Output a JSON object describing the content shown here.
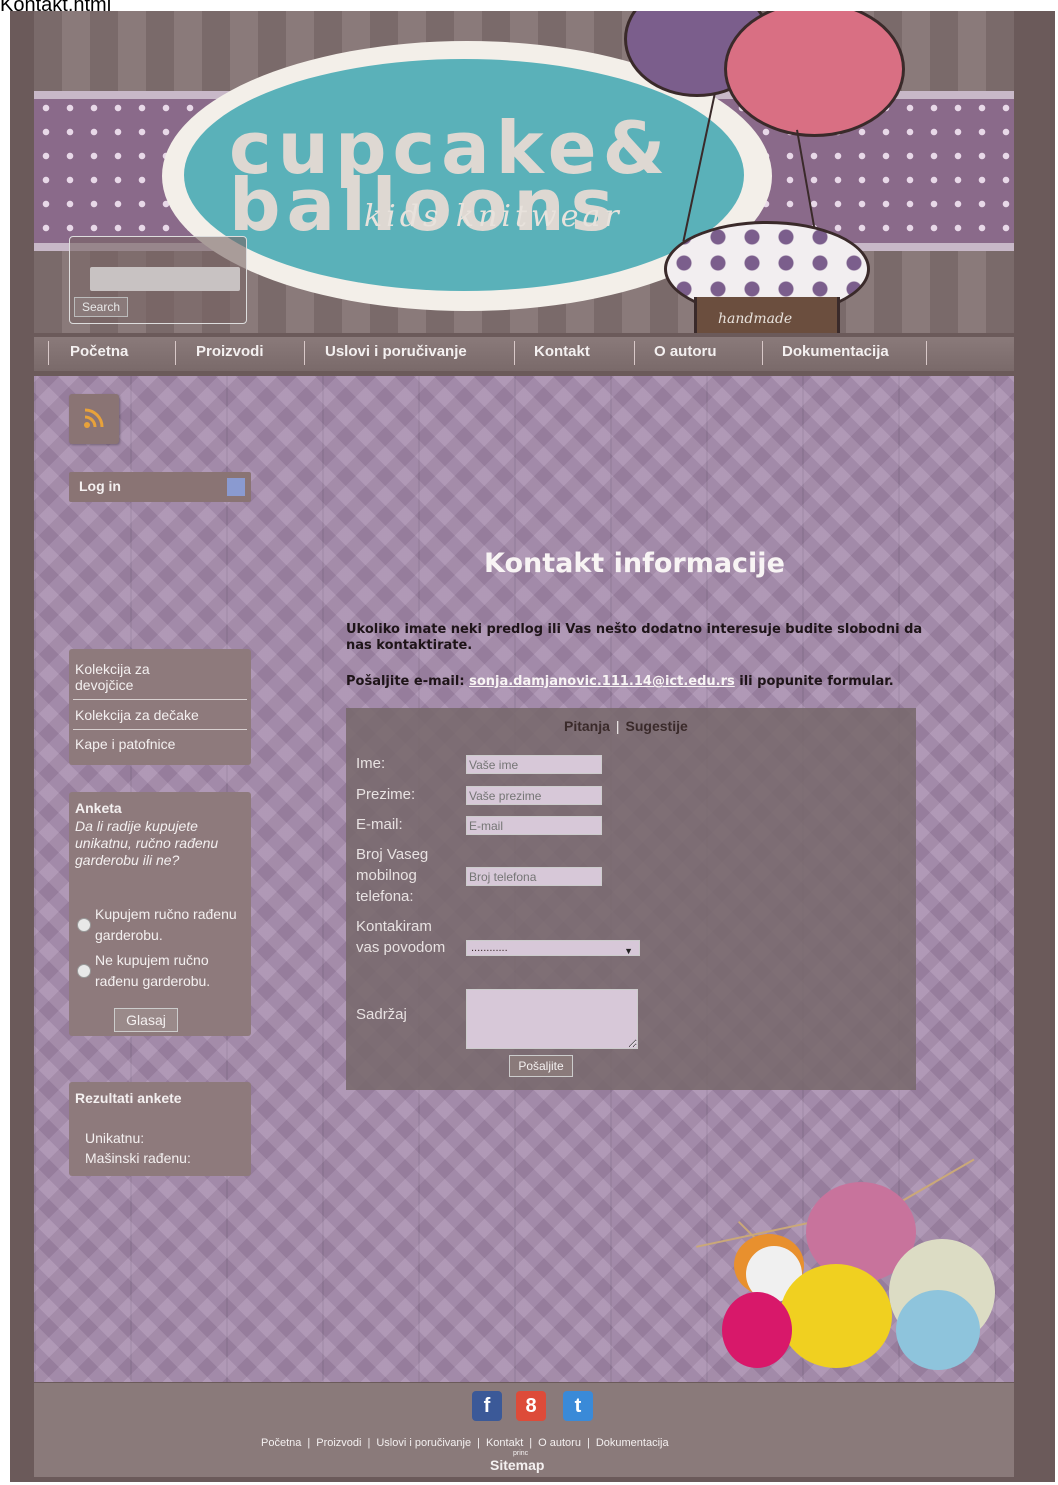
{
  "document_title": "Kontakt.html",
  "header": {
    "logo_line1": "cupcake&",
    "logo_line2": "balloons",
    "logo_sub": "kids knitwear",
    "badge": "handmade",
    "search_button": "Search",
    "search_value": ""
  },
  "nav": {
    "items": [
      "Početna",
      "Proizvodi",
      "Uslovi i poručivanje",
      "Kontakt",
      "O autoru",
      "Dokumentacija"
    ]
  },
  "sidebar": {
    "rss_icon": "rss-icon",
    "login_label": "Log in",
    "menu": [
      "Kolekcija za devojčice",
      "Kolekcija za dečake",
      "Kape i patofnice"
    ],
    "poll": {
      "title": "Anketa",
      "question": "Da li radije kupujete unikatnu, ručno rađenu garderobu ili ne?",
      "options": [
        "Kupujem ručno rađenu garderobu.",
        "Ne kupujem ručno rađenu garderobu."
      ],
      "vote_button": "Glasaj"
    },
    "results": {
      "title": "Rezultati ankete",
      "rows": [
        "Unikatnu:",
        "Mašinski rađenu:"
      ]
    }
  },
  "main": {
    "title": "Kontakt informacije",
    "intro": "Ukoliko imate neki predlog ili Vas nešto dodatno interesuje budite slobodni da nas kontaktirate.",
    "email_prefix": "Pošaljite e-mail:",
    "email": "sonja.damjanovic.111.14@ict.edu.rs",
    "email_suffix": "ili popunite formular.",
    "tabs": [
      "Pitanja",
      "Sugestije"
    ],
    "form": {
      "name_label": "Ime:",
      "name_placeholder": "Vaše ime",
      "surname_label": "Prezime:",
      "surname_placeholder": "Vaše prezime",
      "email_label": "E-mail:",
      "email_placeholder": "E-mail",
      "phone_label": "Broj Vaseg mobilnog telefona:",
      "phone_placeholder": "Broj telefona",
      "reason_label": "Kontakiram vas povodom",
      "reason_value": "............",
      "content_label": "Sadržaj",
      "send_button": "Pošaljite"
    }
  },
  "footer": {
    "social": [
      {
        "icon": "facebook-icon",
        "glyph": "f",
        "color": "#3b5998"
      },
      {
        "icon": "google-plus-icon",
        "glyph": "8",
        "color": "#dd4b39"
      },
      {
        "icon": "twitter-icon",
        "glyph": "t",
        "color": "#3a8ad8"
      }
    ],
    "nav": [
      "Početna",
      "Proizvodi",
      "Uslovi i poručivanje",
      "Kontakt",
      "O autoru",
      "Dokumentacija"
    ],
    "small": "princ",
    "sitemap": "Sitemap"
  }
}
